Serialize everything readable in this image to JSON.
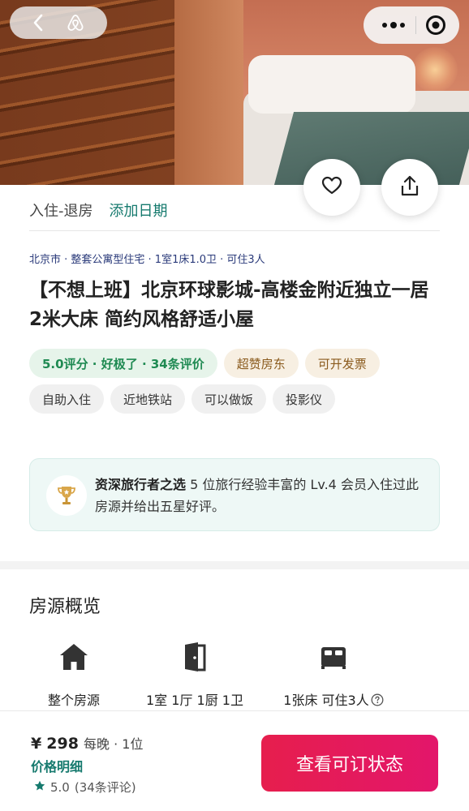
{
  "top_bar": {
    "back_icon": "chevron-left-icon",
    "brand_icon": "airbnb-logo-icon",
    "more_icon": "more-dots-icon",
    "target_icon": "target-icon"
  },
  "actions": {
    "favorite_icon": "heart-icon",
    "share_icon": "share-icon"
  },
  "dates": {
    "label": "入住-退房",
    "add_label": "添加日期"
  },
  "listing": {
    "meta": "北京市 · 整套公寓型住宅 · 1室1床1.0卫 · 可住3人",
    "title": "【不想上班】北京环球影城-高楼金附近独立一居 2米大床 简约风格舒适小屋",
    "tags": [
      {
        "label": "5.0评分 · 好极了 · 34条评价",
        "style": "green"
      },
      {
        "label": "超赞房东",
        "style": "gold"
      },
      {
        "label": "可开发票",
        "style": "gold"
      },
      {
        "label": "自助入住",
        "style": "gray"
      },
      {
        "label": "近地铁站",
        "style": "gray"
      },
      {
        "label": "可以做饭",
        "style": "gray"
      },
      {
        "label": "投影仪",
        "style": "gray"
      }
    ]
  },
  "highlight": {
    "icon": "trophy-icon",
    "bold": "资深旅行者之选",
    "text": " 5 位旅行经验丰富的 Lv.4 会员入住过此房源并给出五星好评。"
  },
  "overview": {
    "title": "房源概览",
    "items": [
      {
        "icon": "house-icon",
        "label": "整个房源"
      },
      {
        "icon": "door-icon",
        "label": "1室 1厅 1厨 1卫"
      },
      {
        "icon": "bed-icon",
        "label": "1张床 可住3人",
        "help_icon": "question-circle-icon"
      }
    ]
  },
  "booking": {
    "currency": "¥",
    "price": "298",
    "unit": "每晚 · 1位",
    "price_detail": "价格明细",
    "rating_icon": "star-icon",
    "rating": "5.0",
    "reviews": "(34条评论)",
    "cta_label": "查看可订状态"
  },
  "colors": {
    "accent": "#167a6e",
    "cta": "#e61e4d",
    "green_tag": "#1f8a52"
  }
}
